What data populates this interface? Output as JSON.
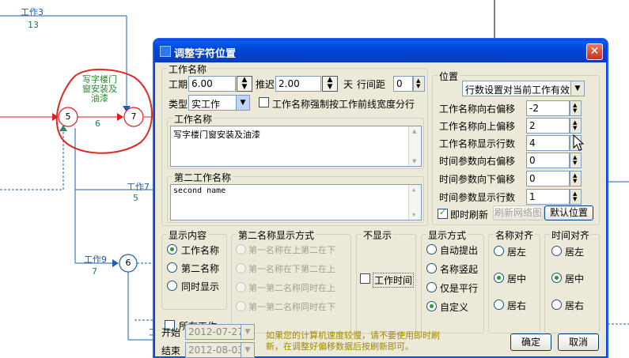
{
  "background": {
    "tasks": [
      {
        "name": "工作3",
        "duration": "13"
      },
      {
        "name": "写字楼门窗安装及油漆",
        "duration": "6"
      },
      {
        "name": "工作7",
        "duration": "5"
      },
      {
        "name": "工作9",
        "duration": "7"
      }
    ],
    "nodes": [
      "5",
      "7",
      "6"
    ],
    "partial_label": "工"
  },
  "dialog": {
    "title": "调整字符位置",
    "close_glyph": "✕",
    "task_name_group": {
      "title": "工作名称",
      "duration_label": "工期",
      "duration_value": "6.00",
      "delay_label": "推迟",
      "delay_value": "2.00",
      "days_unit": "天",
      "line_spacing_label": "行间距",
      "line_spacing_value": "0",
      "type_label": "类型",
      "type_value": "实工作",
      "force_width_label": "工作名称强制按工作前线宽度分行",
      "name_box_title": "工作名称",
      "name_value": "写字楼门窗安装及油漆",
      "second_name_box_title": "第二工作名称",
      "second_name_value": "second name"
    },
    "position_group": {
      "title": "位置",
      "mode_value": "行数设置对当前工作有效",
      "rows": [
        {
          "label": "工作名称向右偏移",
          "value": "-2"
        },
        {
          "label": "工作名称向上偏移",
          "value": "2"
        },
        {
          "label": "工作名称显示行数",
          "value": "4"
        },
        {
          "label": "时间参数向右偏移",
          "value": "0"
        },
        {
          "label": "时间参数向下偏移",
          "value": "0"
        },
        {
          "label": "时间参数显示行数",
          "value": "1"
        }
      ],
      "instant_refresh_label": "即时刷新",
      "refresh_button": "刷新网络图",
      "default_button": "默认位置"
    },
    "display_content": {
      "title": "显示内容",
      "options": [
        "工作名称",
        "第二名称",
        "同时显示"
      ],
      "selected": 0,
      "all_tasks_label": "所有工作"
    },
    "second_name_mode": {
      "title": "第二名称显示方式",
      "options": [
        "第一名称在上第二在下",
        "第一名称在下第二在上",
        "第一第二名称同时在上",
        "第一第二名称同时在下"
      ]
    },
    "hidden": {
      "title": "不显示",
      "work_time_label": "工作时间"
    },
    "display_mode": {
      "title": "显示方式",
      "options": [
        "自动提出",
        "名称竖起",
        "仅是平行",
        "自定义"
      ],
      "selected": 3
    },
    "name_align": {
      "title": "名称对齐",
      "options": [
        "居左",
        "居中",
        "居右"
      ],
      "selected": 1
    },
    "time_align": {
      "title": "时间对齐",
      "options": [
        "居左",
        "居中",
        "居右"
      ],
      "selected": 1
    },
    "start_label": "开始",
    "start_value": "2012-07-27",
    "end_label": "结束",
    "end_value": "2012-08-03",
    "note_line1": "如果您的计算机速度较慢，请不要使用即时刷",
    "note_line2": "新，在调整好偏移数据后按刷新即可。",
    "ok_button": "确定",
    "cancel_button": "取消"
  },
  "colors": {
    "arrow_blue": "#1a5fb4",
    "critical_red": "#e01b24",
    "annotation_red": "#e0281e",
    "title_blue": "#0046d5",
    "dialog_bg": "#ece9d8"
  }
}
